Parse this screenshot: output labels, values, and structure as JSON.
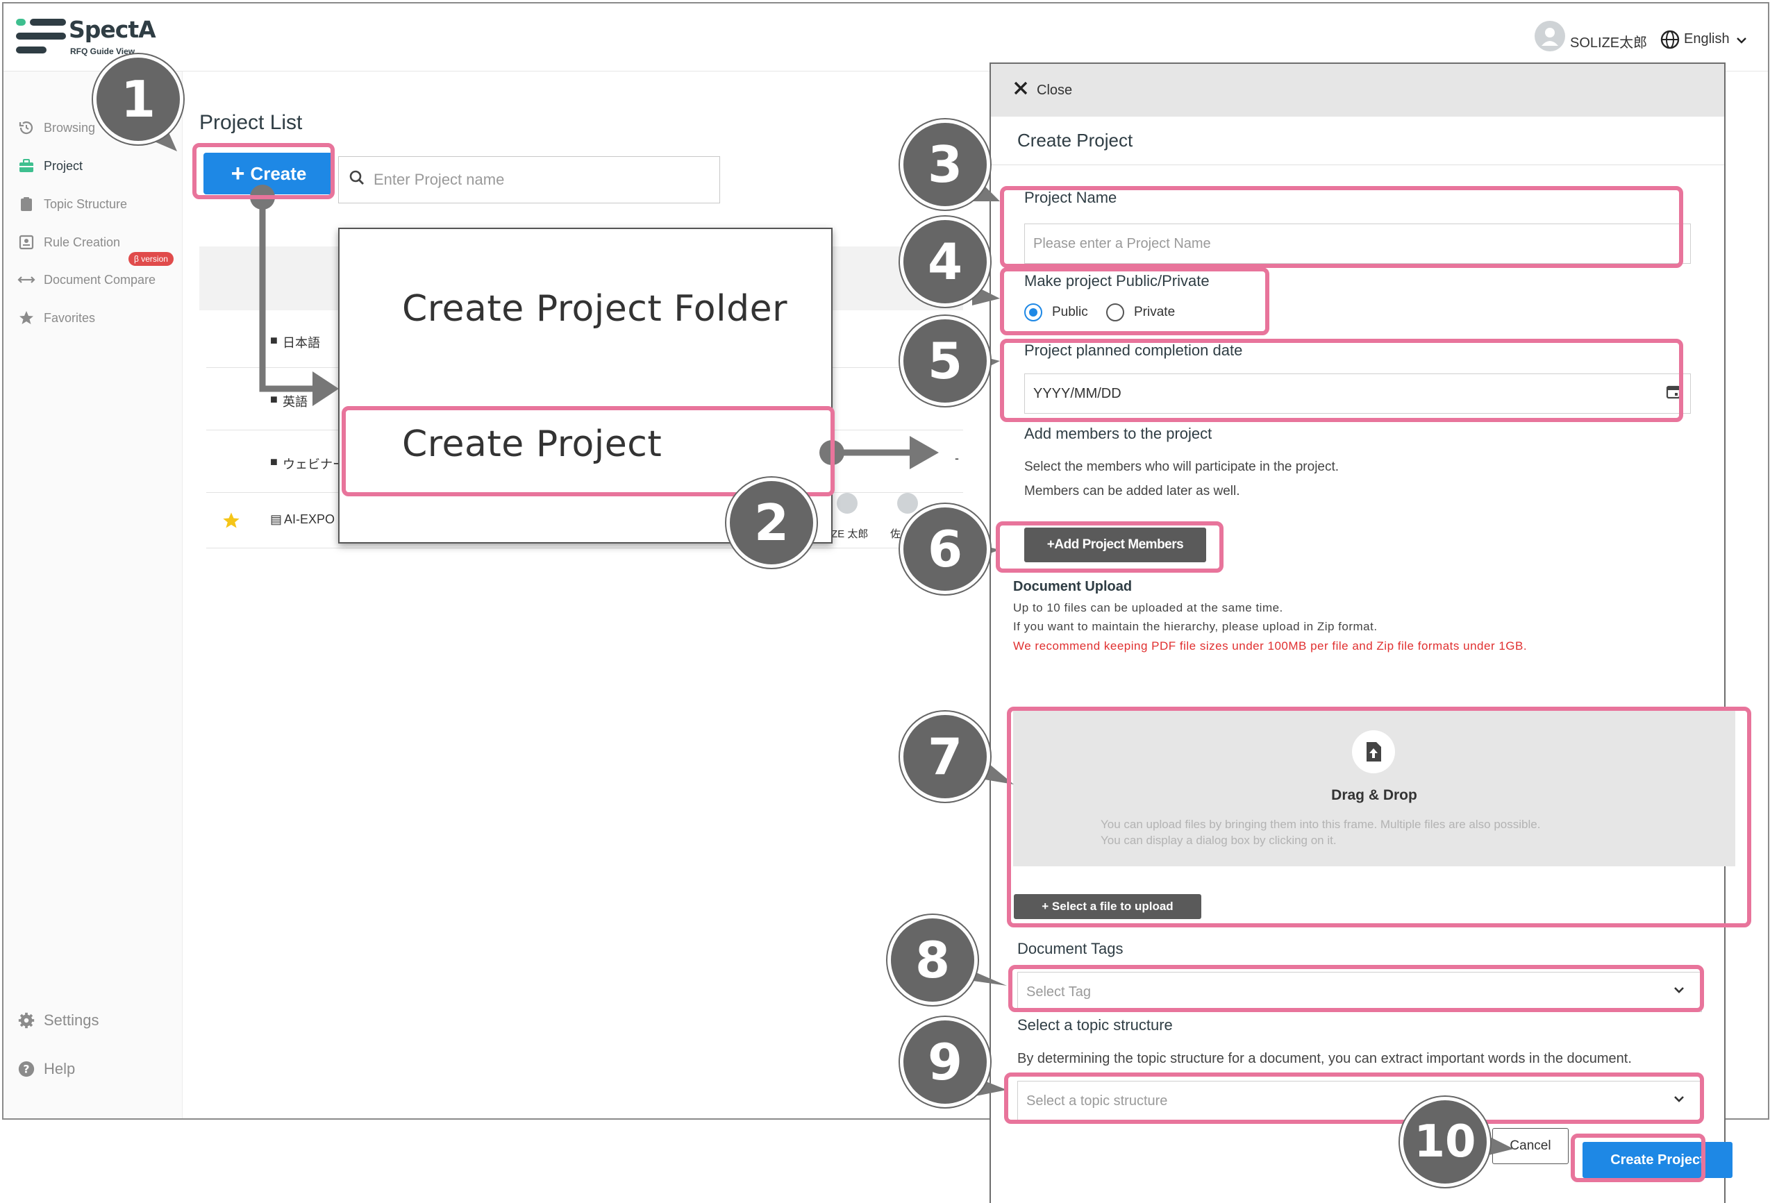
{
  "app": {
    "logo": "SpectA",
    "logo_sub": "RFQ Guide View",
    "user_name": "SOLIZE太郎",
    "language": "English"
  },
  "sidebar": {
    "items": [
      {
        "label": "Browsing",
        "icon": "history-icon"
      },
      {
        "label": "Project",
        "icon": "briefcase-icon"
      },
      {
        "label": "Topic Structure",
        "icon": "clipboard-icon"
      },
      {
        "label": "Rule Creation",
        "icon": "rule-icon"
      },
      {
        "label": "Document Compare",
        "icon": "compare-icon"
      },
      {
        "label": "Favorites",
        "icon": "star-icon"
      }
    ],
    "beta_badge": "β version",
    "settings": "Settings",
    "help": "Help"
  },
  "main": {
    "title": "Project List",
    "create_label": "Create",
    "search_placeholder": "Enter Project name",
    "rows": [
      "日本語",
      "英語",
      "ウェビナー",
      "AI-EXPO"
    ],
    "row_users": [
      "ZE 太郎",
      "佐々"
    ],
    "row_dash": "-"
  },
  "popup": {
    "folder": "Create Project Folder",
    "project": "Create Project"
  },
  "panel": {
    "close": "Close",
    "title": "Create Project",
    "project_name_label": "Project Name",
    "project_name_placeholder": "Please enter a Project Name",
    "visibility_label": "Make project Public/Private",
    "public": "Public",
    "private": "Private",
    "date_label": "Project planned completion date",
    "date_placeholder": "YYYY/MM/DD",
    "members_label": "Add members to the project",
    "members_desc1": "Select the members who will participate in the project.",
    "members_desc2": "Members can be added later as well.",
    "add_members_button": "+Add Project Members",
    "upload_label": "Document Upload",
    "upload_desc1": "Up to 10 files can be uploaded at the same time.",
    "upload_desc2": "If you want to maintain the hierarchy, please upload in Zip format.",
    "upload_warning": "We recommend keeping PDF file sizes under 100MB per file and Zip file formats under 1GB.",
    "drag_drop": "Drag & Drop",
    "drag_desc1": "You can upload files by bringing them into this frame. Multiple files are also possible.",
    "drag_desc2": "You can display a dialog box by clicking on it.",
    "select_file_button": "+ Select a file to upload",
    "tags_label": "Document Tags",
    "tags_placeholder": "Select Tag",
    "topic_label": "Select a topic structure",
    "topic_desc": "By determining the topic structure for a document, you can extract important words in the document.",
    "topic_placeholder": "Select a topic structure",
    "cancel": "Cancel",
    "submit": "Create Project"
  },
  "steps": [
    "1",
    "2",
    "3",
    "4",
    "5",
    "6",
    "7",
    "8",
    "9",
    "10"
  ],
  "colors": {
    "accent": "#1e88e5",
    "highlight": "#e8749b",
    "step_marker": "#666666",
    "warning": "#e03030",
    "logo_green": "#3ebf8f",
    "logo_dark": "#2f3d44"
  }
}
